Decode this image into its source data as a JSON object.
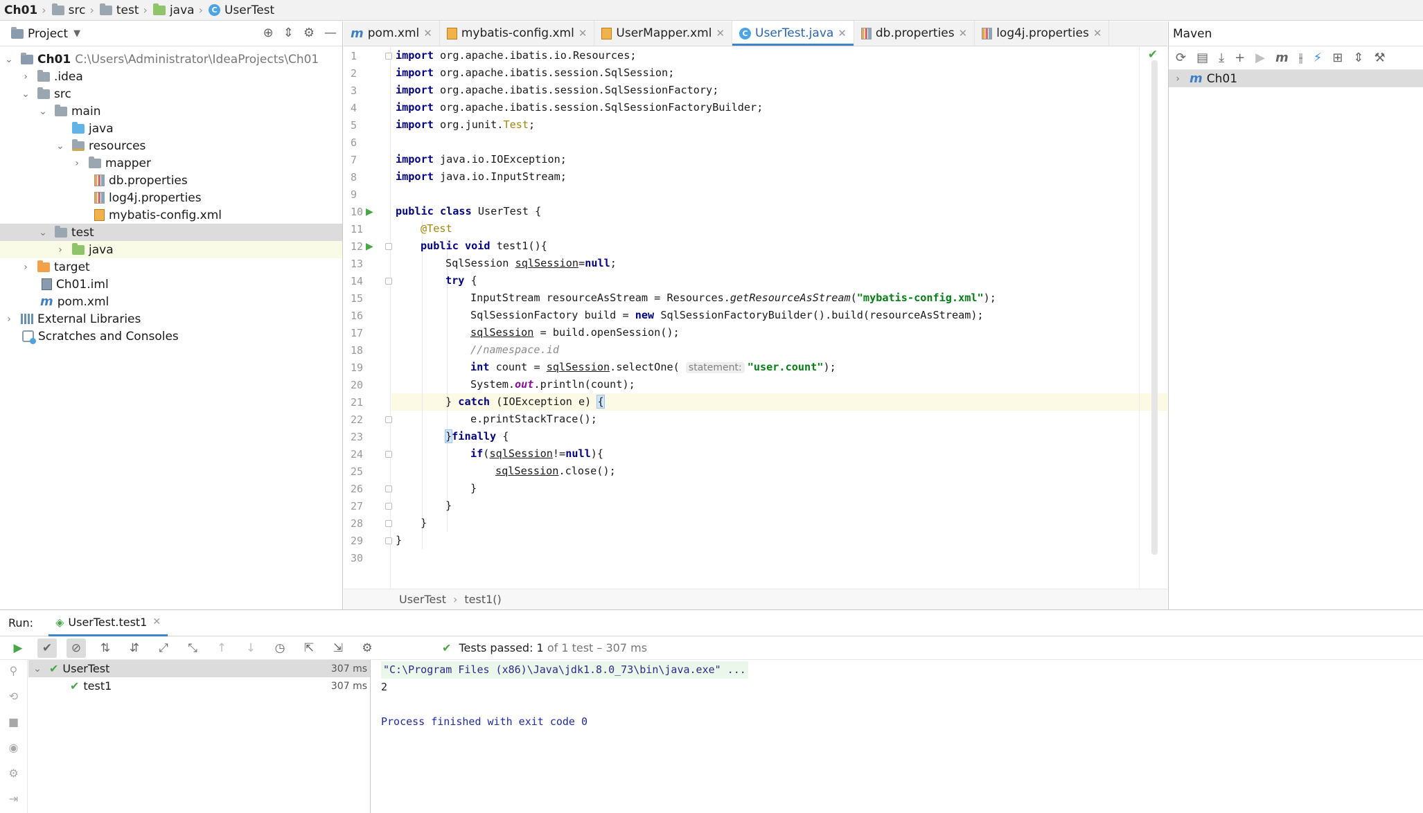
{
  "breadcrumb": [
    "Ch01",
    "src",
    "test",
    "java",
    "UserTest"
  ],
  "project": {
    "title": "Project",
    "tree": [
      {
        "label": "Ch01",
        "path": "C:\\Users\\Administrator\\IdeaProjects\\Ch01"
      },
      {
        "label": ".idea"
      },
      {
        "label": "src"
      },
      {
        "label": "main"
      },
      {
        "label": "java"
      },
      {
        "label": "resources"
      },
      {
        "label": "mapper"
      },
      {
        "label": "db.properties"
      },
      {
        "label": "log4j.properties"
      },
      {
        "label": "mybatis-config.xml"
      },
      {
        "label": "test"
      },
      {
        "label": "java"
      },
      {
        "label": "target"
      },
      {
        "label": "Ch01.iml"
      },
      {
        "label": "pom.xml"
      },
      {
        "label": "External Libraries"
      },
      {
        "label": "Scratches and Consoles"
      }
    ]
  },
  "editor": {
    "tabs": [
      {
        "label": "pom.xml",
        "icon": "maven-icon"
      },
      {
        "label": "mybatis-config.xml",
        "icon": "xml-file-icon"
      },
      {
        "label": "UserMapper.xml",
        "icon": "xml-file-icon"
      },
      {
        "label": "UserTest.java",
        "icon": "class-icon"
      },
      {
        "label": "db.properties",
        "icon": "properties-file-icon"
      },
      {
        "label": "log4j.properties",
        "icon": "properties-file-icon"
      }
    ],
    "active_tab": "UserTest.java",
    "line_numbers": [
      "1",
      "2",
      "3",
      "4",
      "5",
      "6",
      "7",
      "8",
      "9",
      "10",
      "11",
      "12",
      "13",
      "14",
      "15",
      "16",
      "17",
      "18",
      "19",
      "20",
      "21",
      "22",
      "23",
      "24",
      "25",
      "26",
      "27",
      "28",
      "29",
      "30"
    ],
    "code": {
      "l1": "import org.apache.ibatis.io.Resources;",
      "l2": "import org.apache.ibatis.session.SqlSession;",
      "l3": "import org.apache.ibatis.session.SqlSessionFactory;",
      "l4": "import org.apache.ibatis.session.SqlSessionFactoryBuilder;",
      "l5": "import org.junit.Test;",
      "l7": "import java.io.IOException;",
      "l8": "import java.io.InputStream;",
      "l10": "public class UserTest {",
      "l11": "@Test",
      "l12": "public void test1(){",
      "l13": "SqlSession sqlSession=null;",
      "l14": "try {",
      "l15": "InputStream resourceAsStream = Resources.getResourceAsStream(\"mybatis-config.xml\");",
      "l16": "SqlSessionFactory build = new SqlSessionFactoryBuilder().build(resourceAsStream);",
      "l17": "sqlSession = build.openSession();",
      "l18": "//namespace.id",
      "l19": "int count = sqlSession.selectOne( statement: \"user.count\");",
      "l20": "System.out.println(count);",
      "l21": "} catch (IOException e) {",
      "l22": "e.printStackTrace();",
      "l23": "}finally {",
      "l24": "if(sqlSession!=null){",
      "l25": "sqlSession.close();",
      "l26": "}",
      "l27": "}",
      "l28": "}",
      "l29": "}"
    },
    "bottom_breadcrumb": [
      "UserTest",
      "test1()"
    ]
  },
  "maven": {
    "title": "Maven",
    "root": "Ch01"
  },
  "run": {
    "label": "Run:",
    "tab": "UserTest.test1",
    "status": {
      "prefix": "Tests passed:",
      "count": "1",
      "suffix": "of 1 test – 307 ms"
    },
    "tests": [
      {
        "name": "UserTest",
        "time": "307 ms"
      },
      {
        "name": "test1",
        "time": "307 ms"
      }
    ],
    "console": [
      "\"C:\\Program Files (x86)\\Java\\jdk1.8.0_73\\bin\\java.exe\" ...",
      "2",
      "",
      "Process finished with exit code 0"
    ]
  },
  "colors": {
    "accent": "#4083c9",
    "success": "#49a649",
    "keyword": "#000080",
    "string": "#067d17"
  }
}
